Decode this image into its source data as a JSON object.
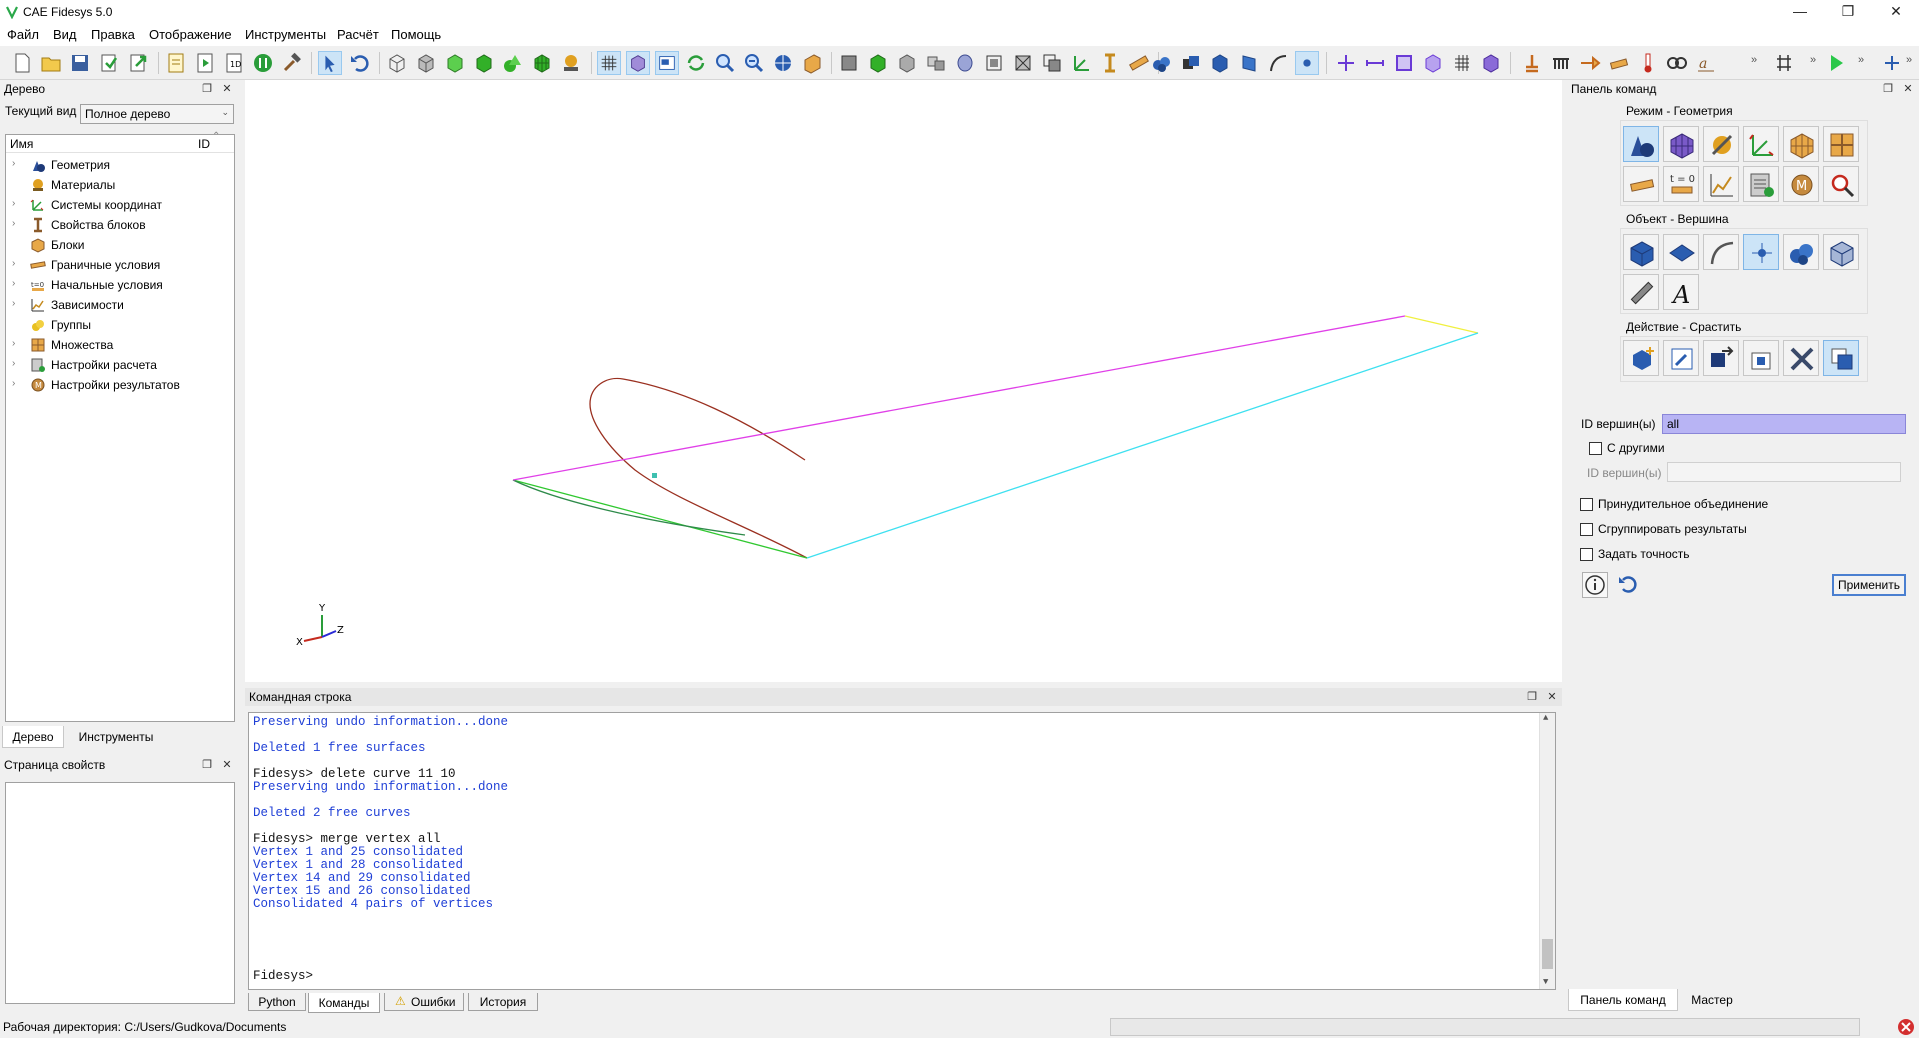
{
  "window": {
    "title": "CAE Fidesys 5.0",
    "minimize": "—",
    "restore": "❐",
    "close": "✕"
  },
  "menu": [
    "Файл",
    "Вид",
    "Правка",
    "Отображение",
    "Инструменты",
    "Расчёт",
    "Помощь"
  ],
  "tree_dock": {
    "title": "Дерево",
    "current_view_label": "Текущий вид",
    "current_view_value": "Полное дерево",
    "col_name": "Имя",
    "col_id": "ID",
    "items": [
      {
        "label": "Геометрия",
        "icon": "geometry-icon",
        "expandable": true
      },
      {
        "label": "Материалы",
        "icon": "materials-icon",
        "expandable": false
      },
      {
        "label": "Системы координат",
        "icon": "coordinate-systems-icon",
        "expandable": true
      },
      {
        "label": "Свойства блоков",
        "icon": "block-properties-icon",
        "expandable": true
      },
      {
        "label": "Блоки",
        "icon": "blocks-icon",
        "expandable": false
      },
      {
        "label": "Граничные условия",
        "icon": "boundary-conditions-icon",
        "expandable": true
      },
      {
        "label": "Начальные условия",
        "icon": "initial-conditions-icon",
        "expandable": true
      },
      {
        "label": "Зависимости",
        "icon": "dependencies-icon",
        "expandable": true
      },
      {
        "label": "Группы",
        "icon": "groups-icon",
        "expandable": false
      },
      {
        "label": "Множества",
        "icon": "sets-icon",
        "expandable": true
      },
      {
        "label": "Настройки расчета",
        "icon": "analysis-settings-icon",
        "expandable": true
      },
      {
        "label": "Настройки результатов",
        "icon": "results-settings-icon",
        "expandable": true
      }
    ],
    "tabs": [
      "Дерево",
      "Инструменты"
    ]
  },
  "props_dock": {
    "title": "Страница свойств"
  },
  "cmd_dock": {
    "title": "Командная строка",
    "lines": [
      {
        "text": "Preserving undo information...done",
        "style": "blue"
      },
      {
        "text": "",
        "style": "blue"
      },
      {
        "text": "Deleted 1 free surfaces",
        "style": "blue"
      },
      {
        "text": "",
        "style": "blue"
      },
      {
        "text": "Fidesys> delete curve 11 10",
        "style": "black"
      },
      {
        "text": "Preserving undo information...done",
        "style": "blue"
      },
      {
        "text": "",
        "style": "blue"
      },
      {
        "text": "Deleted 2 free curves",
        "style": "blue"
      },
      {
        "text": "",
        "style": "blue"
      },
      {
        "text": "Fidesys> merge vertex all",
        "style": "black"
      },
      {
        "text": "Vertex 1 and 25 consolidated",
        "style": "blue"
      },
      {
        "text": "Vertex 1 and 28 consolidated",
        "style": "blue"
      },
      {
        "text": "Vertex 14 and 29 consolidated",
        "style": "blue"
      },
      {
        "text": "Vertex 15 and 26 consolidated",
        "style": "blue"
      },
      {
        "text": "Consolidated 4 pairs of vertices",
        "style": "blue"
      },
      {
        "text": "",
        "style": "blue"
      },
      {
        "text": "Fidesys>",
        "style": "black"
      }
    ],
    "tabs": [
      "Python",
      "Команды",
      "Ошибки",
      "История"
    ]
  },
  "command_panel": {
    "title": "Панель команд",
    "mode_label": "Режим - Геометрия",
    "object_label": "Объект - Вершина",
    "action_label": "Действие - Срастить",
    "vertex_ids_label": "ID вершин(ы)",
    "vertex_ids_value": "all",
    "with_others_label": "С другими",
    "other_ids_label": "ID вершин(ы)",
    "force_merge_label": "Принудительное объединение",
    "group_results_label": "Сгруппировать результаты",
    "set_tolerance_label": "Задать точность",
    "apply_label": "Применить",
    "time_zero_label": "t = 0",
    "tabs": [
      "Панель команд",
      "Мастер"
    ]
  },
  "axes": {
    "x": "X",
    "y": "Y",
    "z": "Z"
  },
  "status": {
    "working_dir": "Рабочая директория: C:/Users/Gudkova/Documents"
  },
  "colors": {
    "magenta_curve": "#e040e8",
    "cyan_curve": "#3ee0f0",
    "yellow_curve": "#f0f040",
    "green_curve": "#30c830",
    "darkgreen_curve": "#2e8a4a",
    "brown_curve": "#9a3020",
    "output_blue": "#1f3fd6"
  }
}
